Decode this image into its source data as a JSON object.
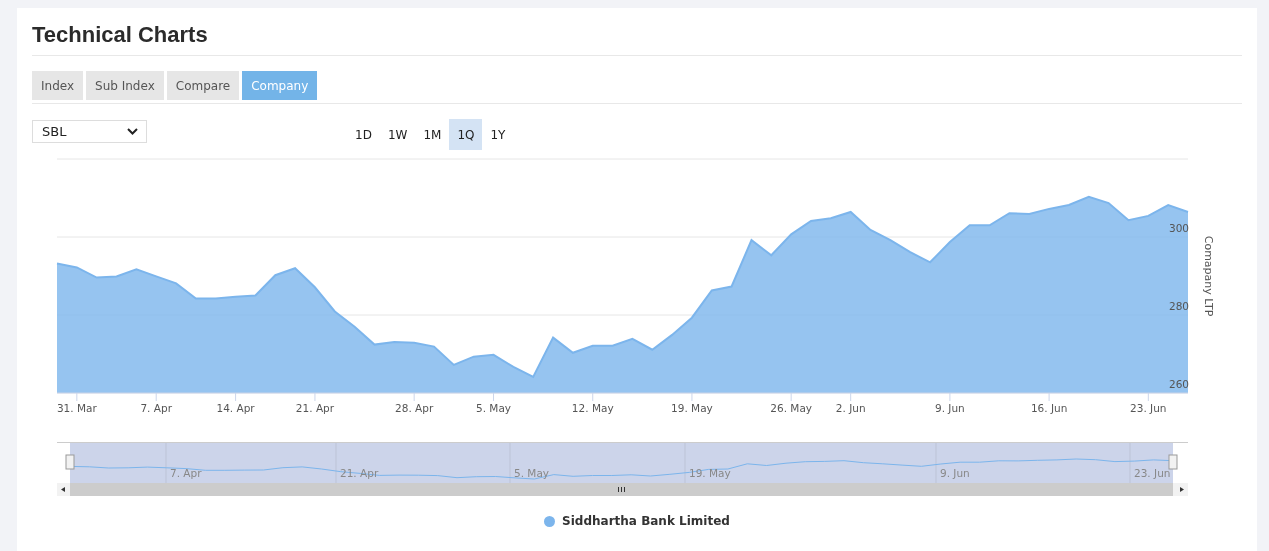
{
  "title": "Technical Charts",
  "tabs": [
    {
      "label": "Index",
      "selected": false
    },
    {
      "label": "Sub Index",
      "selected": false
    },
    {
      "label": "Compare",
      "selected": false
    },
    {
      "label": "Company",
      "selected": true
    }
  ],
  "company_select": {
    "value": "SBL"
  },
  "ranges": [
    {
      "label": "1D",
      "selected": false
    },
    {
      "label": "1W",
      "selected": false
    },
    {
      "label": "1M",
      "selected": false
    },
    {
      "label": "1Q",
      "selected": true
    },
    {
      "label": "1Y",
      "selected": false
    }
  ],
  "chart": {
    "chart_data": {
      "type": "area",
      "ylabel": "Comapany LTP",
      "ylim": [
        260,
        320
      ],
      "yticks": [
        260,
        280,
        300
      ],
      "categories": [
        null,
        "31. Mar",
        null,
        null,
        null,
        "7. Apr",
        null,
        null,
        null,
        "14. Apr",
        null,
        null,
        null,
        "21. Apr",
        null,
        null,
        null,
        null,
        "28. Apr",
        null,
        null,
        null,
        "5. May",
        null,
        null,
        null,
        null,
        "12. May",
        null,
        null,
        null,
        null,
        "19. May",
        null,
        null,
        null,
        null,
        "26. May",
        null,
        null,
        "2. Jun",
        null,
        null,
        null,
        null,
        "9. Jun",
        null,
        null,
        null,
        null,
        "16. Jun",
        null,
        null,
        null,
        null,
        "23. Jun",
        null,
        null
      ],
      "series": [
        {
          "name": "Siddhartha Bank Limited",
          "color": "#7cb5ec",
          "values": [
            293.2,
            292.2,
            289.6,
            289.9,
            291.7,
            289.9,
            288.1,
            284.2,
            284.2,
            284.7,
            285.0,
            290.2,
            292.0,
            287.1,
            280.9,
            277.0,
            272.4,
            273.1,
            272.9,
            271.9,
            267.2,
            269.3,
            269.8,
            266.7,
            264.1,
            274.2,
            270.3,
            272.1,
            272.1,
            273.9,
            271.1,
            274.9,
            279.3,
            286.3,
            287.3,
            299.2,
            295.3,
            300.7,
            304.1,
            304.8,
            306.4,
            301.8,
            299.2,
            296.1,
            293.5,
            298.7,
            303.0,
            303.0,
            306.1,
            305.9,
            307.2,
            308.2,
            310.3,
            308.7,
            304.3,
            305.4,
            308.2,
            306.4
          ]
        }
      ]
    }
  },
  "navigator": {
    "labels": [
      "7. Apr",
      "21. Apr",
      "5. May",
      "19. May",
      "9. Jun",
      "23. Jun"
    ]
  }
}
